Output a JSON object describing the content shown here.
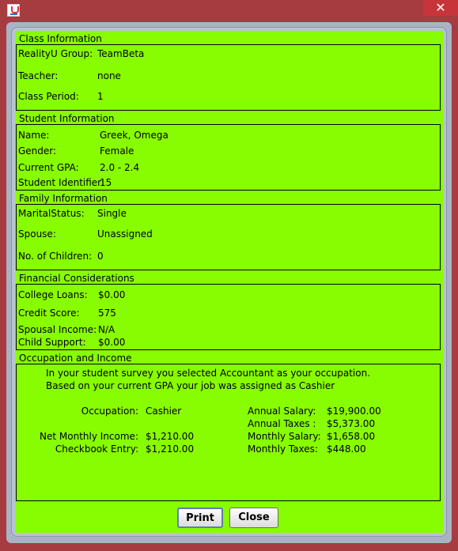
{
  "window": {
    "close_glyph": "✕",
    "icon": "java-icon"
  },
  "class_info": {
    "title": "Class Information",
    "rows": [
      {
        "label": "RealityU Group:",
        "value": "TeamBeta"
      },
      {
        "label": "Teacher:",
        "value": "none"
      },
      {
        "label": "Class Period:",
        "value": "1"
      }
    ]
  },
  "student_info": {
    "title": "Student Information",
    "rows": [
      {
        "label": "Name:",
        "value": "Greek, Omega"
      },
      {
        "label": "Gender:",
        "value": "Female"
      },
      {
        "label": "Current GPA:",
        "value": "2.0 - 2.4"
      },
      {
        "label": "Student Identifier:",
        "value": "15"
      }
    ]
  },
  "family_info": {
    "title": "Family Information",
    "rows": [
      {
        "label": "MaritalStatus:",
        "value": "Single"
      },
      {
        "label": "Spouse:",
        "value": "Unassigned"
      },
      {
        "label": "No. of Children:",
        "value": "0"
      }
    ]
  },
  "financial": {
    "title": "Financial Considerations",
    "rows": [
      {
        "label": "College Loans:",
        "value": "$0.00"
      },
      {
        "label": "Credit Score:",
        "value": "575"
      },
      {
        "label": "Spousal Income:",
        "value": "N/A"
      },
      {
        "label": "Child Support:",
        "value": "$0.00"
      }
    ]
  },
  "occupation": {
    "title": "Occupation and Income",
    "line1": "In your student survey you selected Accountant as your occupation.",
    "line2": "Based on your current GPA your job was assigned as Cashier",
    "occupation_label": "Occupation:",
    "occupation_value": "Cashier",
    "net_monthly_label": "Net Monthly Income:",
    "net_monthly_value": "$1,210.00",
    "checkbook_label": "Checkbook Entry:",
    "checkbook_value": "$1,210.00",
    "annual_salary_label": "Annual Salary:",
    "annual_salary_value": "$19,900.00",
    "annual_taxes_label": "Annual Taxes :",
    "annual_taxes_value": "$5,373.00",
    "monthly_salary_label": "Monthly Salary:",
    "monthly_salary_value": "$1,658.00",
    "monthly_taxes_label": "Monthly Taxes:",
    "monthly_taxes_value": "$448.00"
  },
  "buttons": {
    "print": "Print",
    "close": "Close"
  },
  "colors": {
    "panel": "#88fc00",
    "frame": "#a63b40"
  }
}
